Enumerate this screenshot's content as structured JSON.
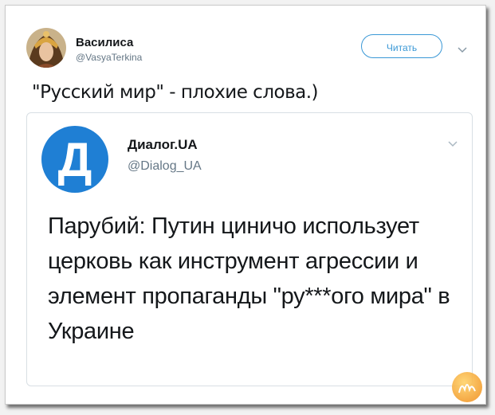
{
  "tweet": {
    "author": {
      "name": "Василиса",
      "handle": "@VasyaTerkina",
      "avatar_icon": "woman-portrait-avatar"
    },
    "follow_label": "Читать",
    "menu_icon": "chevron-down-icon",
    "text": "\"Русский мир\" - плохие слова.)"
  },
  "quoted": {
    "logo_letter": "Д",
    "logo_color": "#1f7fd4",
    "name": "Диалог.UA",
    "handle": "@Dialog_UA",
    "menu_icon": "chevron-down-icon",
    "text": "Парубий: Путин циничо использует церковь как инструмент агрессии и элемент пропаганды \"ру***ого мира\" в Украине"
  },
  "colors": {
    "accent": "#3a98d6",
    "text_primary": "#14171a",
    "text_secondary": "#657786"
  },
  "watermark_icon": "nyka-watermark-logo"
}
